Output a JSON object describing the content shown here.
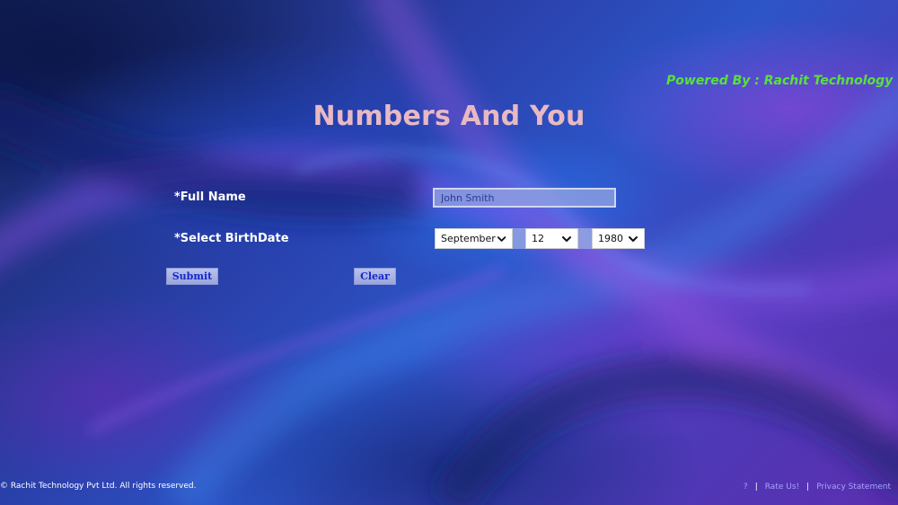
{
  "header": {
    "powered_by": "Powered By : Rachit Technology",
    "title": "Numbers And You"
  },
  "form": {
    "full_name_label": "*Full Name",
    "full_name_value": "John Smith",
    "birthdate_label": "*Select BirthDate",
    "birth_month": "September",
    "birth_day": "12",
    "birth_year": "1980",
    "submit_label": "Submit",
    "clear_label": "Clear"
  },
  "footer": {
    "copyright": "© Rachit Technology Pvt Ltd. All rights reserved.",
    "help_link": "?",
    "separator": "|",
    "rate_link": "Rate Us!",
    "privacy_link": "Privacy Statement"
  },
  "colors": {
    "powered_by": "#58e23a",
    "title": "#e8b9c4",
    "button_text": "#1626c9",
    "footer_link": "#a9a2ff"
  },
  "icons": {
    "dropdown": "chevron-down-icon"
  }
}
